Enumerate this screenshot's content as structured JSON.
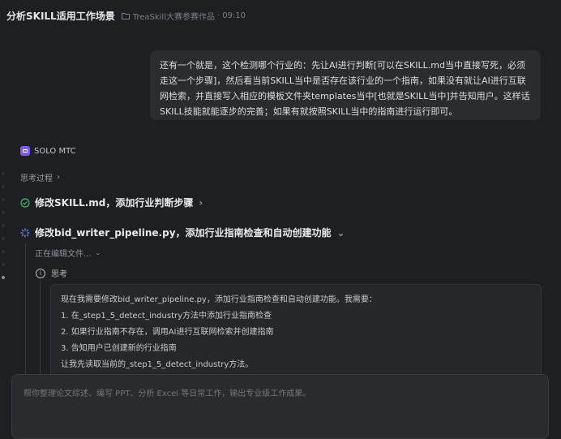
{
  "header": {
    "title": "分析SKILL适用工作场景",
    "folder_label": "TreaSkill大赛参赛作品",
    "separator": "·",
    "time": "09:10"
  },
  "user_message": "还有一个就是，这个检测哪个行业的：先让AI进行判断[可以在SKILL.md当中直接写死，必须走这一个步骤]，然后看当前SKILL当中是否存在该行业的一个指南，如果没有就让AI进行互联网检索，并直接写入相应的模板文件夹templates当中[也就是SKILL当中]并告知用户。这样话SKILL技能就能逐步的完善；如果有就按照SKILL当中的指南进行运行即可。",
  "agent": {
    "name": "SOLO MTC",
    "thinking_label": "思考过程"
  },
  "steps": {
    "step1": "修改SKILL.md，添加行业判断步骤",
    "step2": "修改bid_writer_pipeline.py，添加行业指南检查和自动创建功能"
  },
  "editing_label": "正在编辑文件...",
  "thinking_block": {
    "label": "思考",
    "intro": "现在我需要修改bid_writer_pipeline.py，添加行业指南检查和自动创建功能。我需要：",
    "items": [
      "1. 在_step1_5_detect_industry方法中添加行业指南检查",
      "2. 如果行业指南不存在，调用AI进行互联网检索并创建指南",
      "3. 告知用户已创建新的行业指南"
    ],
    "outro": "让我先读取当前的_step1_5_detect_industry方法。"
  },
  "composer": {
    "placeholder": "帮你整理论文综述、编写 PPT、分析 Excel 等日常工作，输出专业级工作成果。"
  },
  "colors": {
    "accent": "#7a5cf0",
    "success": "#3fb96c",
    "loading": "#6c8cff"
  }
}
